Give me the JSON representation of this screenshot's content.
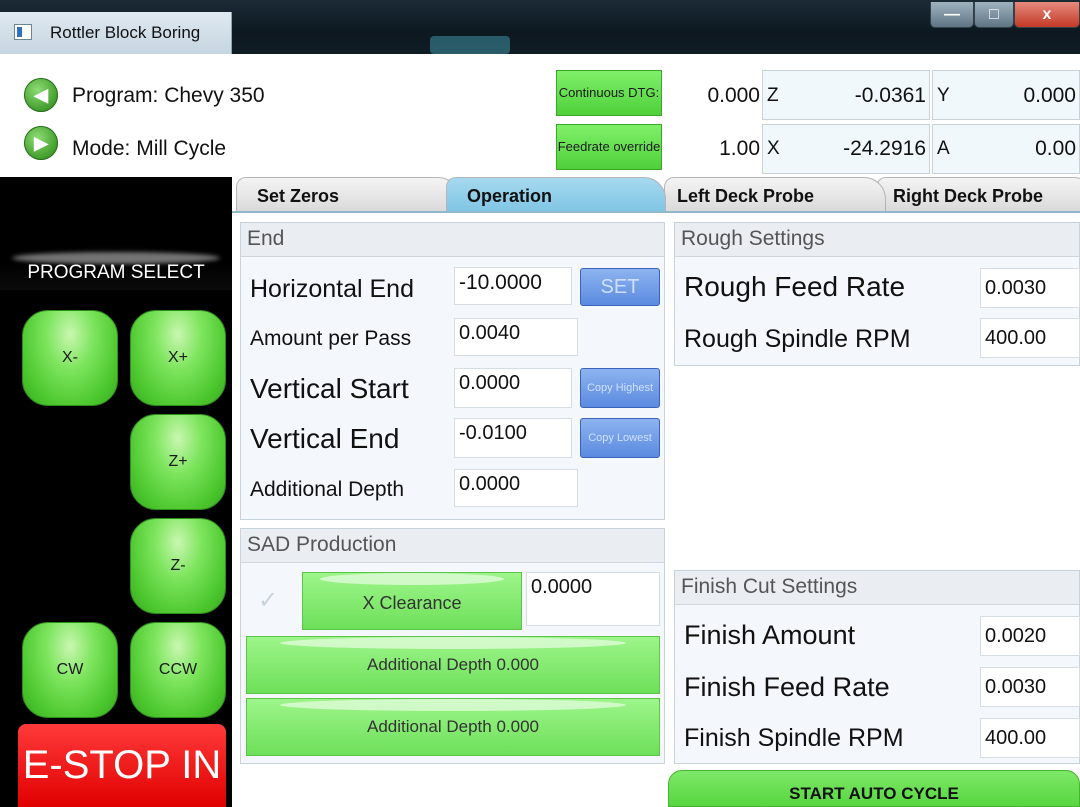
{
  "window": {
    "title": "Rottler Block Boring",
    "minimize": "—",
    "maximize": "□",
    "close": "x"
  },
  "header": {
    "program": "Program: Chevy 350",
    "mode": "Mode: Mill Cycle",
    "continuous_btn": "Continuous DTG:",
    "feedrate_btn": "Feedrate override",
    "dtg_value": "0.000",
    "feedrate_value": "1.00",
    "axes": [
      {
        "label": "Z",
        "value": "-0.0361"
      },
      {
        "label": "X",
        "value": "-24.2916"
      },
      {
        "label": "Y",
        "value": "0.000"
      },
      {
        "label": "A",
        "value": "0.00"
      }
    ]
  },
  "jog": {
    "title": "PROGRAM SELECT",
    "x_minus": "X-",
    "x_plus": "X+",
    "z_plus": "Z+",
    "z_minus": "Z-",
    "cw": "CW",
    "ccw": "CCW",
    "estop": "E-STOP IN"
  },
  "tabs": [
    "Set Zeros",
    "Operation",
    "Left Deck Probe",
    "Right Deck Probe"
  ],
  "active_tab": "Operation",
  "end_group": {
    "title": "End",
    "horizontal_end_label": "Horizontal End",
    "horizontal_end_value": "-10.0000",
    "set_btn": "SET",
    "amount_per_pass_label": "Amount per Pass",
    "amount_per_pass_value": "0.0040",
    "vertical_start_label": "Vertical Start",
    "vertical_start_value": "0.0000",
    "copy_highest_btn": "Copy Highest",
    "vertical_end_label": "Vertical End",
    "vertical_end_value": "-0.0100",
    "copy_lowest_btn": "Copy Lowest",
    "additional_depth_label": "Additional Depth",
    "additional_depth_value": "0.0000"
  },
  "sad_group": {
    "title": "SAD Production",
    "check_mark": "✓",
    "x_clearance_btn": "X Clearance",
    "x_clearance_value": "0.0000",
    "additional_depth_btn_1": "Additional Depth 0.000",
    "additional_depth_btn_2": "Additional Depth 0.000"
  },
  "rough_group": {
    "title": "Rough Settings",
    "feed_rate_label": "Rough Feed Rate",
    "feed_rate_value": "0.0030",
    "spindle_rpm_label": "Rough Spindle RPM",
    "spindle_rpm_value": "400.00"
  },
  "finish_group": {
    "title": "Finish Cut Settings",
    "amount_label": "Finish Amount",
    "amount_value": "0.0020",
    "feed_rate_label": "Finish Feed Rate",
    "feed_rate_value": "0.0030",
    "spindle_rpm_label": "Finish Spindle RPM",
    "spindle_rpm_value": "400.00"
  },
  "start_button": "START AUTO CYCLE"
}
